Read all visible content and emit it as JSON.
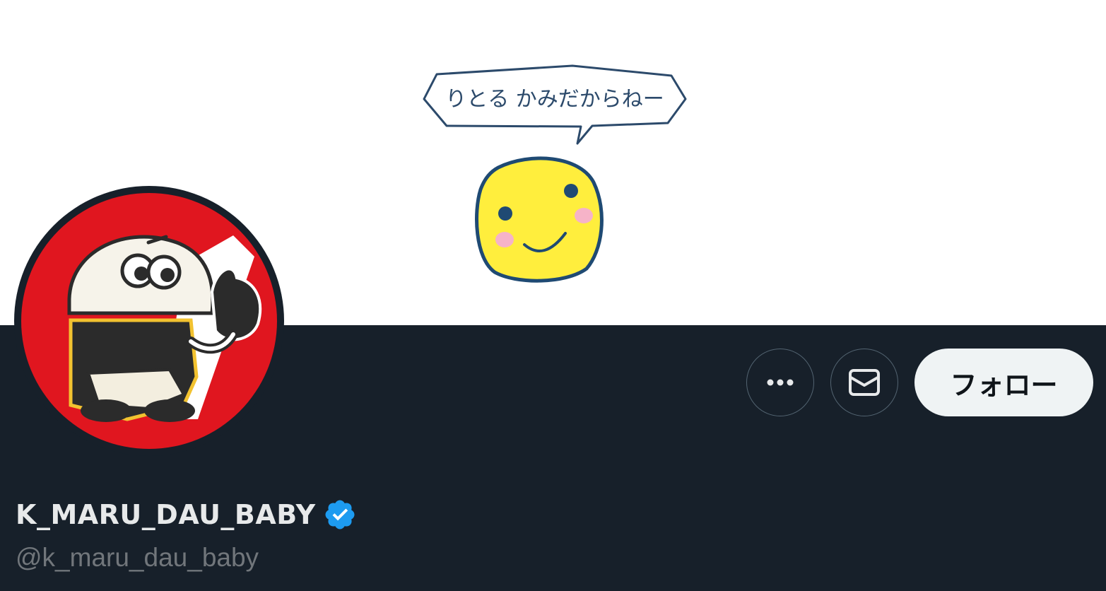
{
  "banner": {
    "speech_bubble_text": "りとる かみだからねー"
  },
  "profile": {
    "display_name": "K_MARU_DAU_BABY",
    "handle": "@k_maru_dau_baby",
    "verified": true
  },
  "actions": {
    "more_icon": "ellipsis-icon",
    "message_icon": "envelope-icon",
    "follow_label": "フォロー"
  },
  "colors": {
    "background": "#17202a",
    "verified_blue": "#1d9bf0",
    "follow_bg": "#eff3f4",
    "avatar_red": "#e0161f"
  }
}
